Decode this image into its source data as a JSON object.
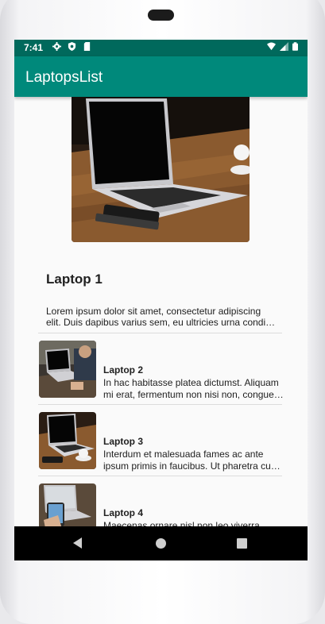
{
  "status_bar": {
    "time": "7:41",
    "left_icons": [
      "gear-icon",
      "shield-icon",
      "sd-card-icon"
    ],
    "right_icons": [
      "wifi-icon",
      "signal-icon",
      "battery-icon"
    ]
  },
  "app_bar": {
    "title": "LaptopsList"
  },
  "featured": {
    "title": "Laptop 1",
    "description_lines": [
      "Lorem ipsum dolor sit amet, consectetur adipiscing",
      "elit. Duis dapibus varius sem, eu ultricies urna condi…"
    ]
  },
  "items": [
    {
      "title": "Laptop 2",
      "description_lines": [
        "In hac habitasse platea dictumst. Aliquam",
        "mi erat, fermentum non nisi non, congue…"
      ]
    },
    {
      "title": "Laptop 3",
      "description_lines": [
        "Interdum et malesuada fames ac ante",
        "ipsum primis in faucibus. Ut pharetra cu…"
      ]
    },
    {
      "title": "Laptop 4",
      "description_lines": [
        "Maecenas ornare nisl non leo viverra"
      ]
    }
  ],
  "nav_bar": {
    "icons": [
      "back-icon",
      "home-icon",
      "recents-icon"
    ]
  },
  "colors": {
    "status_bar": "#00695c",
    "app_bar": "#00897b",
    "nav_bar": "#000000"
  }
}
